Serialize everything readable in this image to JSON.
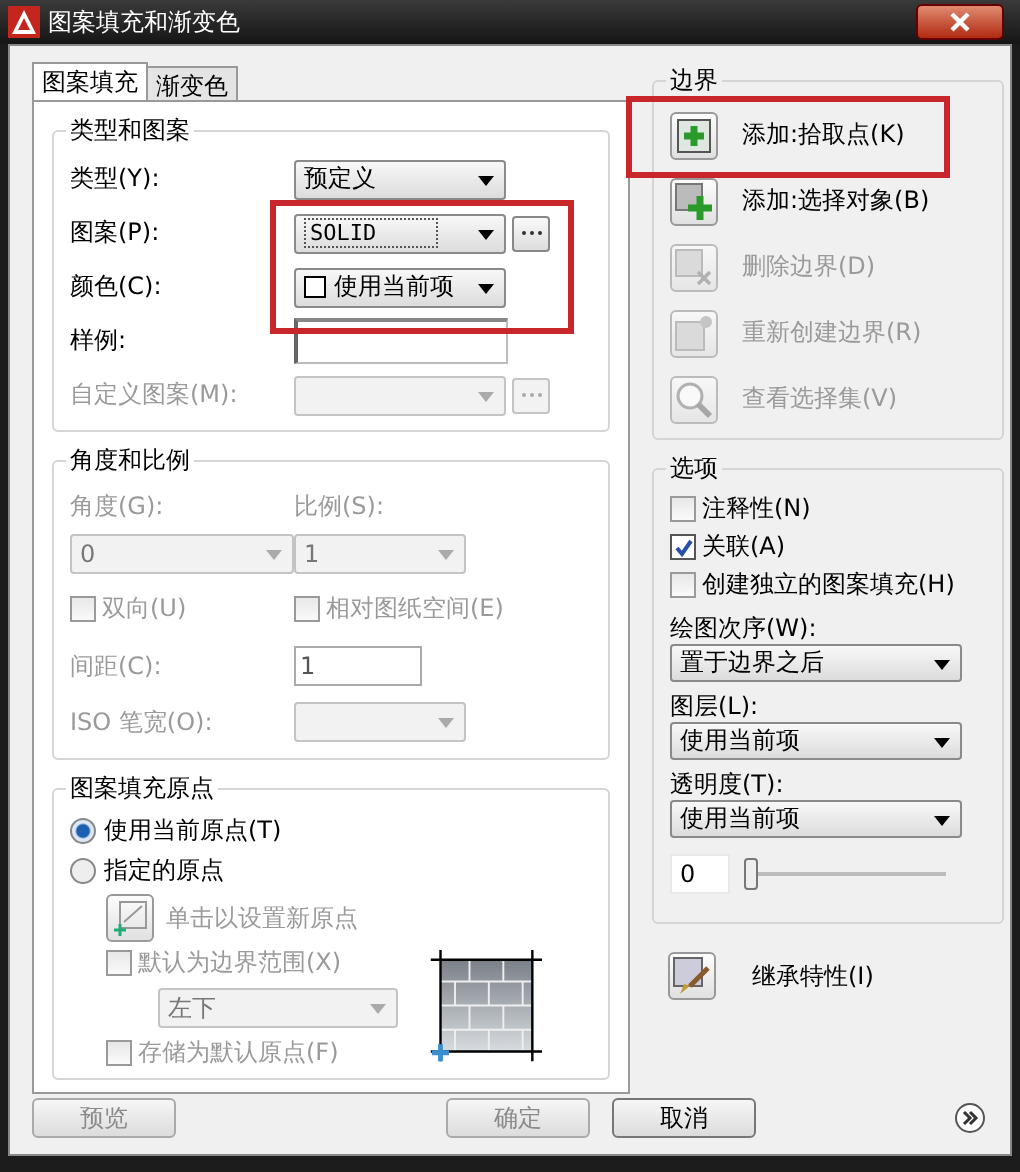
{
  "window": {
    "title": "图案填充和渐变色"
  },
  "tabs": [
    {
      "label": "图案填充",
      "selected": true
    },
    {
      "label": "渐变色",
      "selected": false
    }
  ],
  "type_pattern": {
    "title": "类型和图案",
    "rows": [
      {
        "label": "类型(Y):",
        "value": "预定义",
        "kind": "dropdown",
        "disabled": false
      },
      {
        "label": "图案(P):",
        "value": "SOLID",
        "kind": "dropdown_browse",
        "disabled": false
      },
      {
        "label": "颜色(C):",
        "value": "使用当前项",
        "kind": "color_dropdown",
        "disabled": false
      },
      {
        "label": "样例:",
        "kind": "sample",
        "disabled": false
      },
      {
        "label": "自定义图案(M):",
        "kind": "dropdown_browse",
        "disabled": true
      }
    ]
  },
  "angle_scale": {
    "title": "角度和比例",
    "angle": {
      "label": "角度(G):",
      "value": "0",
      "disabled": true
    },
    "scale": {
      "label": "比例(S):",
      "value": "1",
      "disabled": true
    },
    "double": {
      "label": "双向(U)",
      "checked": false,
      "disabled": true
    },
    "relative": {
      "label": "相对图纸空间(E)",
      "checked": false,
      "disabled": true
    },
    "spacing": {
      "label": "间距(C):",
      "value": "1",
      "disabled": true
    },
    "iso": {
      "label": "ISO 笔宽(O):",
      "disabled": true
    }
  },
  "origin": {
    "title": "图案填充原点",
    "radios": [
      {
        "label": "使用当前原点(T)",
        "selected": true
      },
      {
        "label": "指定的原点",
        "selected": false
      }
    ],
    "set_button": {
      "label": "单击以设置新原点",
      "disabled": true
    },
    "default_extent": {
      "label": "默认为边界范围(X)",
      "checked": false,
      "disabled": true
    },
    "position": {
      "value": "左下",
      "disabled": true
    },
    "store": {
      "label": "存储为默认原点(F)",
      "checked": false,
      "disabled": true
    }
  },
  "boundary": {
    "title": "边界",
    "buttons": [
      {
        "label": "添加:拾取点(K)",
        "kind": "pick",
        "disabled": false
      },
      {
        "label": "添加:选择对象(B)",
        "kind": "select",
        "disabled": false
      },
      {
        "label": "删除边界(D)",
        "kind": "remove",
        "disabled": true
      },
      {
        "label": "重新创建边界(R)",
        "kind": "recreate",
        "disabled": true
      },
      {
        "label": "查看选择集(V)",
        "kind": "view",
        "disabled": true
      }
    ]
  },
  "options": {
    "title": "选项",
    "checkboxes": [
      {
        "label": "注释性(N)",
        "checked": false
      },
      {
        "label": "关联(A)",
        "checked": true
      },
      {
        "label": "创建独立的图案填充(H)",
        "checked": false
      }
    ],
    "selects": [
      {
        "label": "绘图次序(W):",
        "value": "置于边界之后"
      },
      {
        "label": "图层(L):",
        "value": "使用当前项"
      },
      {
        "label": "透明度(T):",
        "value": "使用当前项"
      }
    ],
    "transparency": {
      "value": "0",
      "level": 0
    }
  },
  "inherit": {
    "label": "继承特性(I)"
  },
  "footer": [
    {
      "label": "预览",
      "disabled": true
    },
    {
      "label": "确定",
      "disabled": true
    },
    {
      "label": "取消",
      "disabled": false
    }
  ]
}
